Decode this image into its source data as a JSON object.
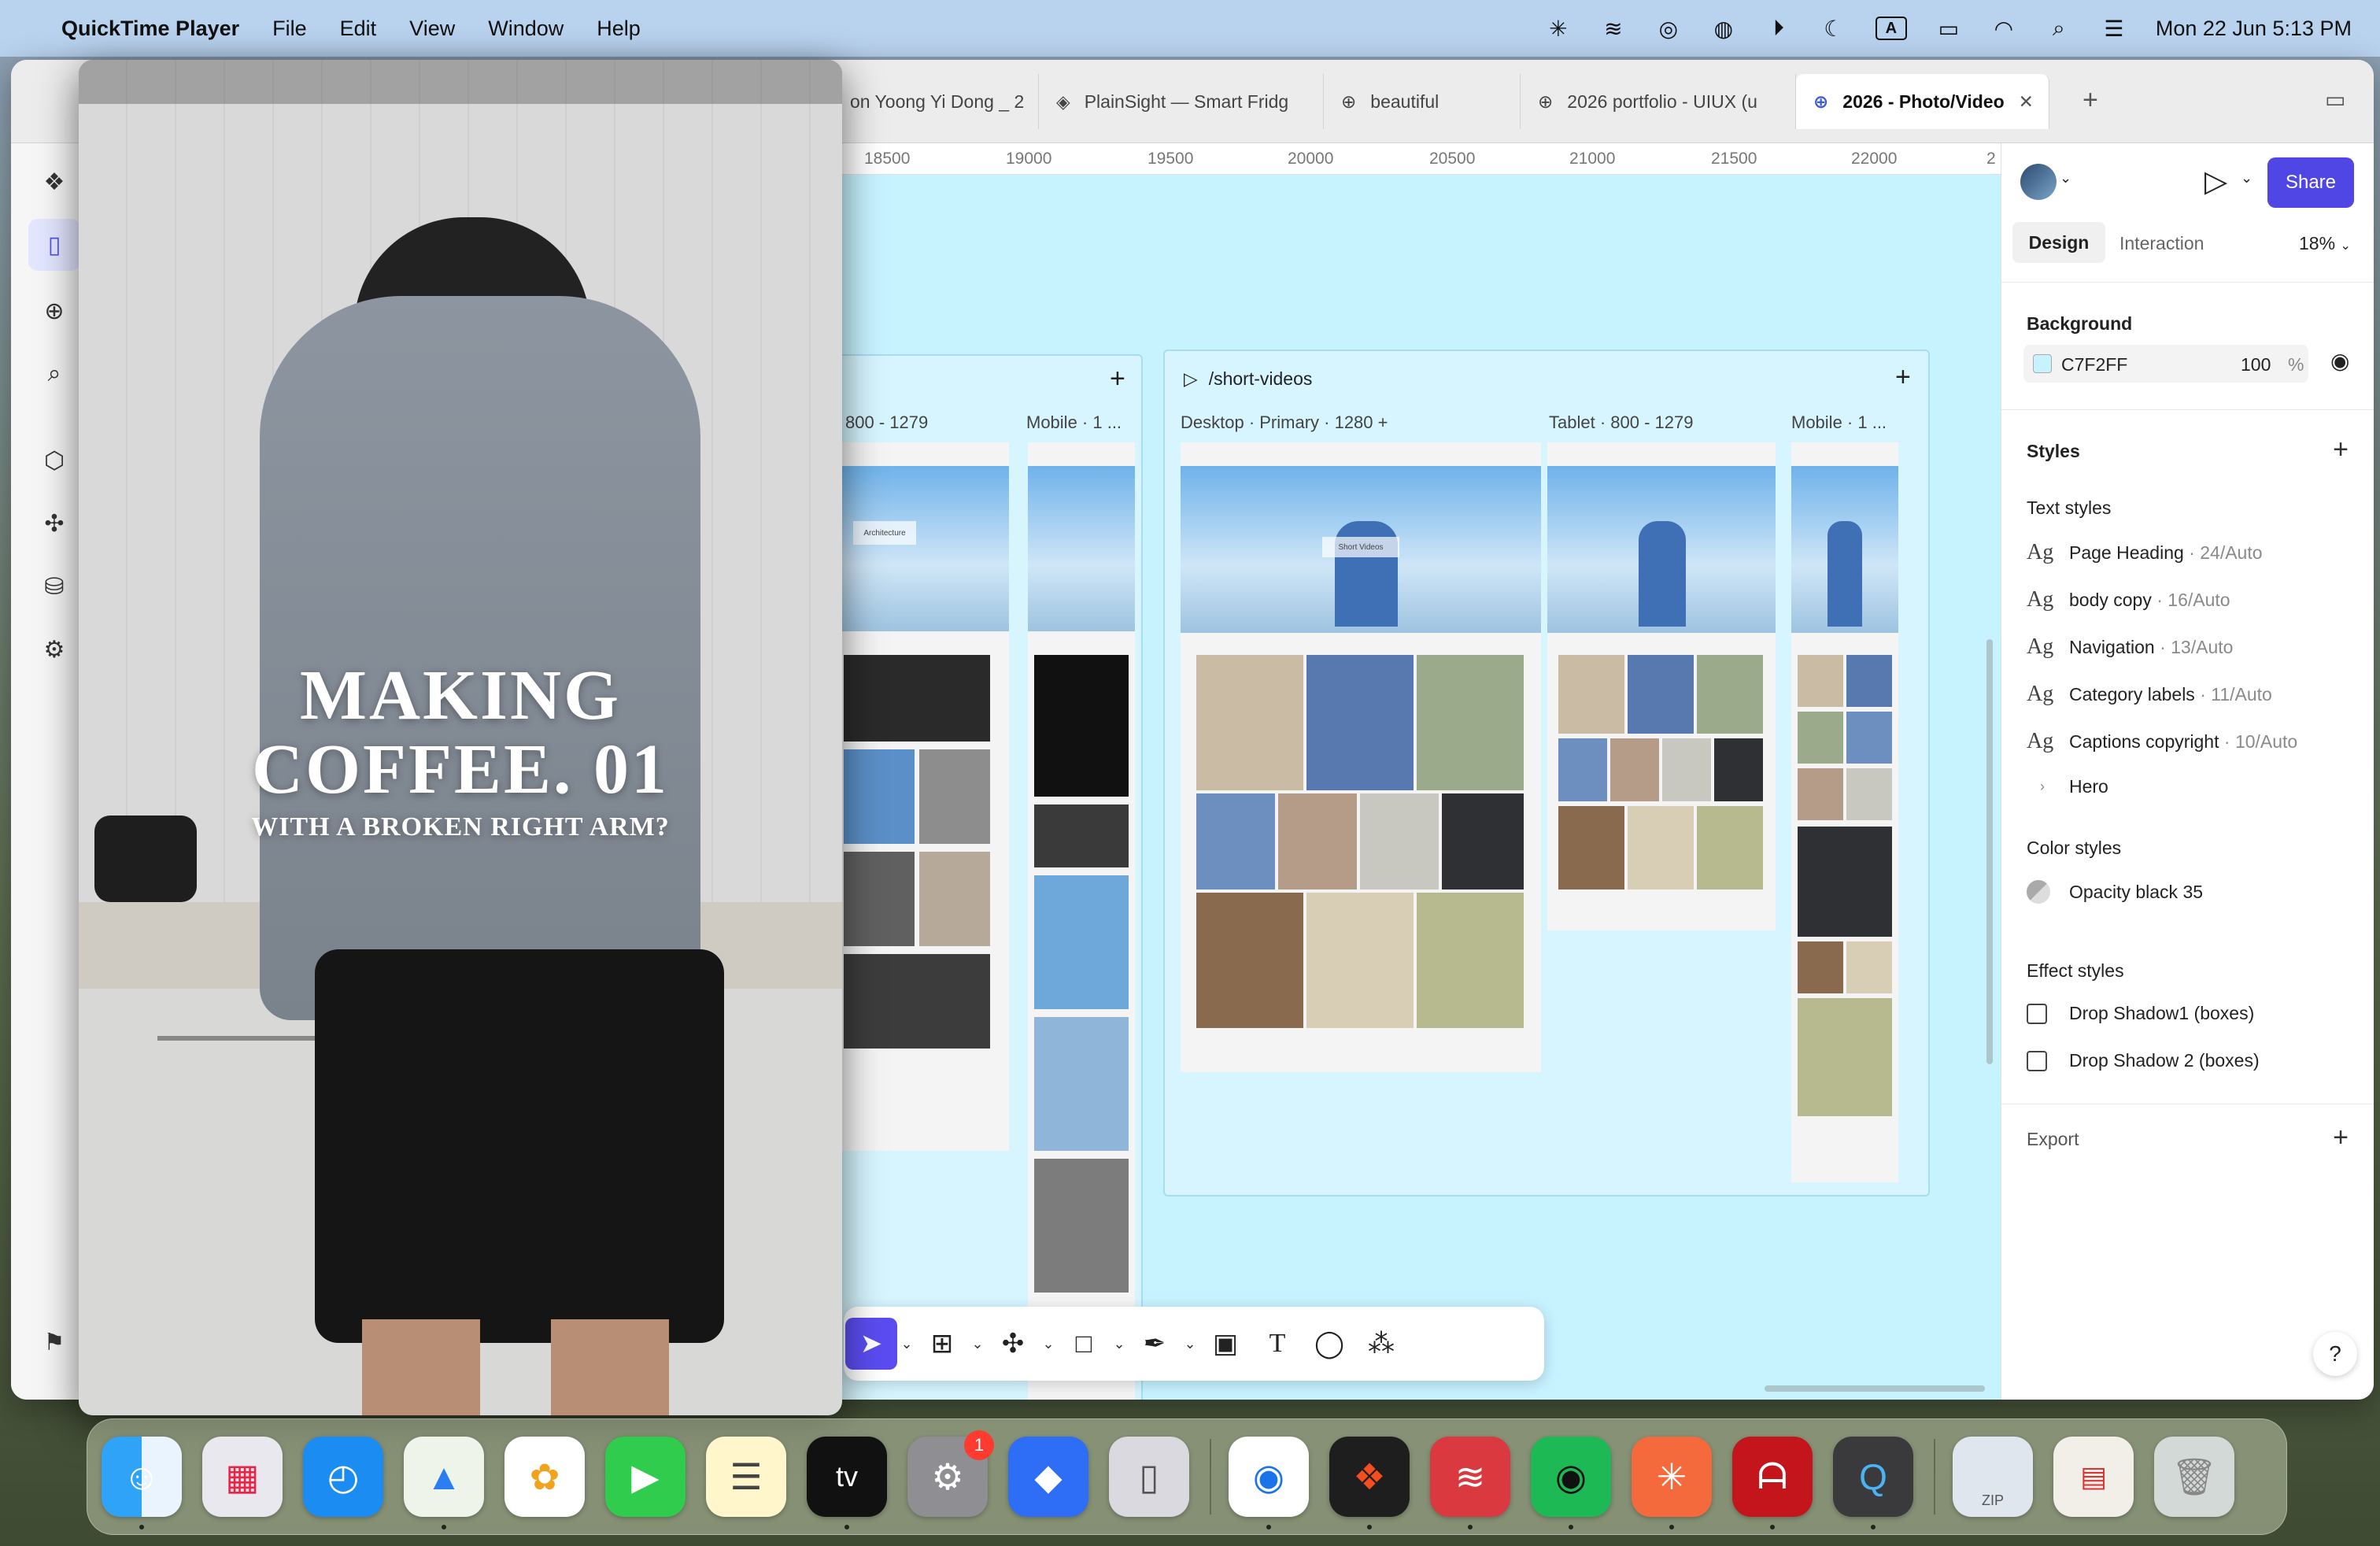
{
  "menubar": {
    "app_name": "QuickTime Player",
    "menus": [
      "File",
      "Edit",
      "View",
      "Window",
      "Help"
    ],
    "clock": "Mon 22 Jun  5:13 PM",
    "input_letter": "A"
  },
  "browser_tabs": [
    {
      "label": "on Yoong Yi Dong _ 2"
    },
    {
      "label": "PlainSight — Smart Fridg"
    },
    {
      "label": "beautiful"
    },
    {
      "label": "2026 portfolio - UIUX (u"
    },
    {
      "label": "2026 - Photo/Video"
    }
  ],
  "ruler": [
    "18500",
    "19000",
    "19500",
    "20000",
    "20500",
    "21000",
    "21500",
    "22000",
    "2"
  ],
  "canvas": {
    "left_section": {
      "frame_labels": [
        "800 - 1279",
        "Mobile · 1 ..."
      ],
      "hero_caption": "Architecture"
    },
    "right_section": {
      "title": "/short-videos",
      "frame_labels": [
        "Desktop · Primary · 1280 +",
        "Tablet · 800 - 1279",
        "Mobile · 1 ..."
      ],
      "hero_caption": "Short Videos"
    }
  },
  "right_panel": {
    "share_label": "Share",
    "tab_design": "Design",
    "tab_interaction": "Interaction",
    "zoom": "18%",
    "background_heading": "Background",
    "background_hex": "C7F2FF",
    "background_opacity": "100",
    "percent": "%",
    "styles_heading": "Styles",
    "text_styles_heading": "Text styles",
    "text_styles": [
      {
        "name": "Page Heading",
        "meta": " · 24/Auto"
      },
      {
        "name": "body copy",
        "meta": " · 16/Auto"
      },
      {
        "name": "Navigation",
        "meta": " · 13/Auto"
      },
      {
        "name": "Category labels",
        "meta": " · 11/Auto"
      },
      {
        "name": "Captions copyright",
        "meta": " · 10/Auto"
      }
    ],
    "hero_group": "Hero",
    "color_styles_heading": "Color styles",
    "color_style": "Opacity black 35",
    "effect_styles_heading": "Effect styles",
    "effect_styles": [
      "Drop Shadow1 (boxes)",
      "Drop Shadow 2 (boxes)"
    ],
    "export_heading": "Export",
    "help": "?",
    "ag": "Ag"
  },
  "video": {
    "title_line1": "MAKING",
    "title_line2": "COFFEE. 01",
    "subtitle": "WITH A BROKEN RIGHT ARM?"
  },
  "dock": {
    "settings_badge": "1",
    "appletv_label": "tv",
    "zip_label": "ZIP"
  },
  "colors": {
    "canvas_bg": "#C7F2FF",
    "accent": "#5A4CF0",
    "share": "#4F46E5",
    "menubar": "#B9D2EE"
  }
}
